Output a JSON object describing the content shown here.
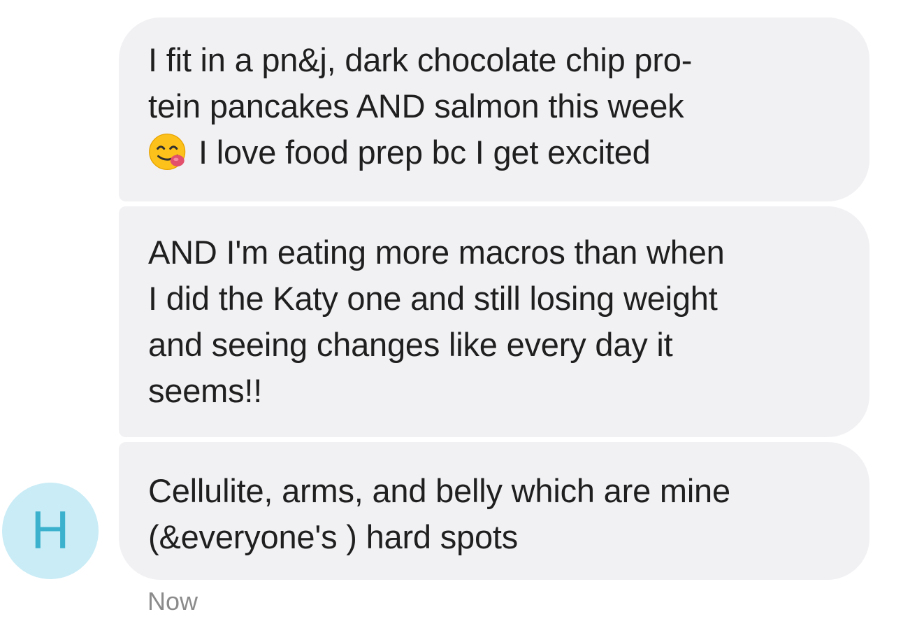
{
  "messages": [
    {
      "lines": [
        "I fit in a pn&j, dark chocolate chip pro-",
        "tein pancakes AND salmon this week",
        "I love food prep bc I get excited"
      ],
      "emoji": "face-savoring-food-icon"
    },
    {
      "lines": [
        "AND I'm eating more macros than when",
        "I did the Katy one and still losing weight",
        "and seeing changes like every day it",
        "seems!!"
      ]
    },
    {
      "lines": [
        "Cellulite, arms, and belly which are mine",
        "(&everyone's ) hard spots"
      ]
    }
  ],
  "sender": {
    "initial": "H",
    "avatar_bg": "#c9ecf6",
    "avatar_fg": "#3bb1cd"
  },
  "timestamp": "Now",
  "colors": {
    "bubble_bg": "#f1f1f4",
    "text": "#1f1f1f",
    "timestamp": "#8b8b8b"
  }
}
